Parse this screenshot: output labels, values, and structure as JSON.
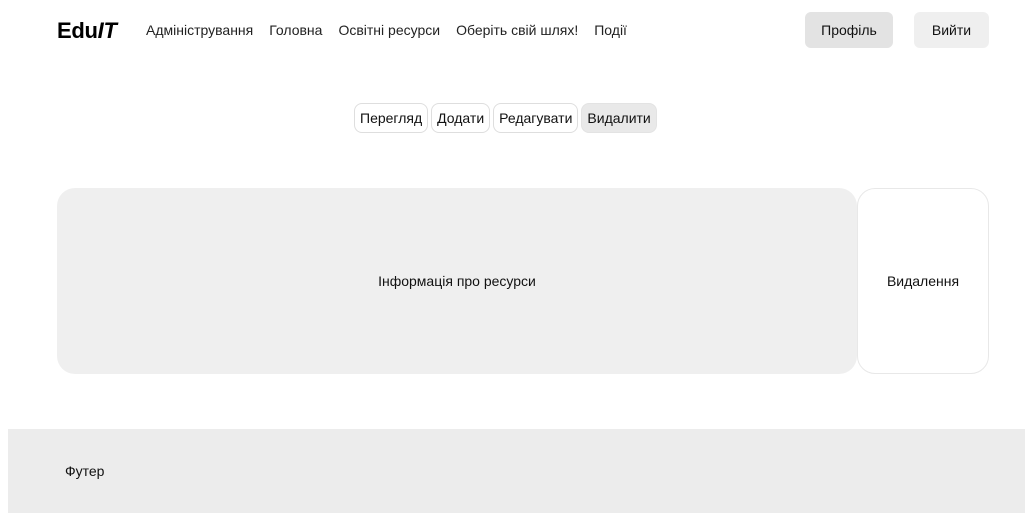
{
  "header": {
    "logo": {
      "main": "Edu",
      "italic": "IT"
    },
    "nav": [
      {
        "label": "Адміністрування"
      },
      {
        "label": "Головна"
      },
      {
        "label": "Освітні ресурси"
      },
      {
        "label": "Оберіть свій шлях!"
      },
      {
        "label": "Події"
      }
    ],
    "profile_label": "Профіль",
    "logout_label": "Вийти"
  },
  "tabs": [
    {
      "label": "Перегляд",
      "active": false
    },
    {
      "label": "Додати",
      "active": false
    },
    {
      "label": "Редагувати",
      "active": false
    },
    {
      "label": "Видалити",
      "active": true
    }
  ],
  "main": {
    "info_label": "Інформація про ресурси",
    "delete_label": "Видалення"
  },
  "footer": {
    "label": "Футер"
  }
}
